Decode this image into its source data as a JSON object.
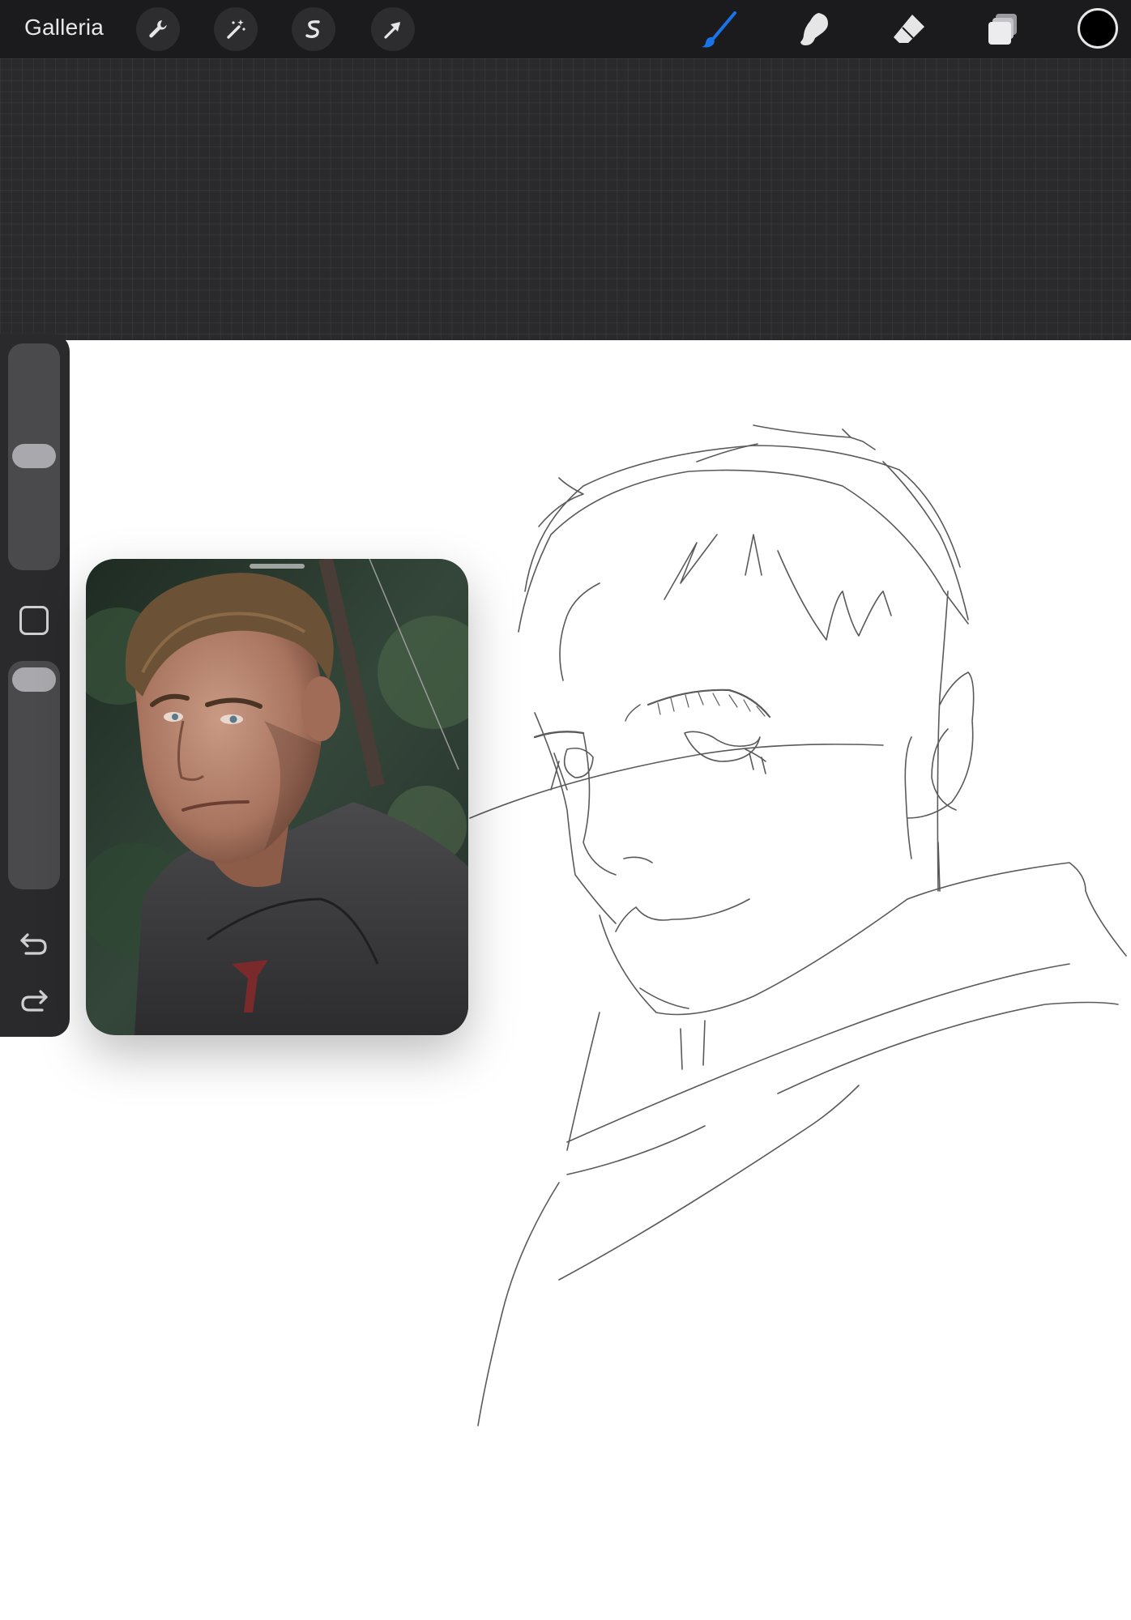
{
  "toolbar": {
    "gallery_label": "Galleria",
    "left_tools": [
      "wrench-icon",
      "magic-wand-icon",
      "selection-s-icon",
      "transform-arrow-icon"
    ],
    "right_tools": [
      "brush-icon",
      "smudge-icon",
      "eraser-icon",
      "layers-icon"
    ],
    "active_tool": "brush-icon",
    "current_color": "#000000",
    "accent_color": "#1a73e8"
  },
  "sidebar": {
    "brush_size_level": 0.48,
    "opacity_level": 0.95,
    "icons": [
      "modify-square-icon",
      "undo-icon",
      "redo-icon"
    ]
  },
  "reference": {
    "image": "portrait-reference"
  }
}
